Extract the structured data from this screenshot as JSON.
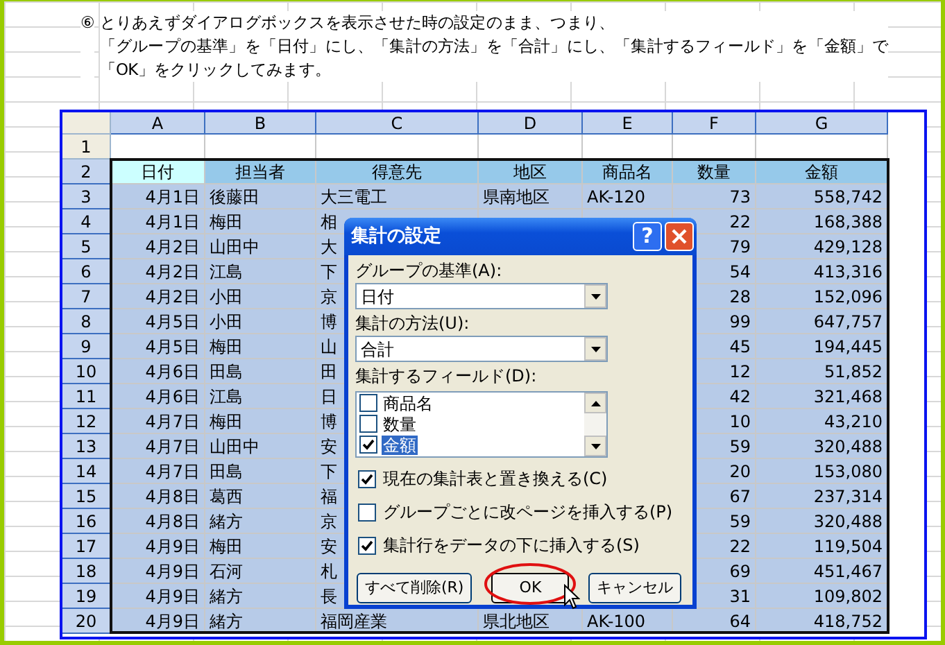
{
  "instruction": {
    "marker": "⑥",
    "lines": [
      "とりあえずダイアログボックスを表示させた時の設定のまま、つまり、",
      "「グループの基準」を「日付」にし、「集計の方法」を「合計」にし、「集計するフィールド」を「金額」で",
      "「OK」をクリックしてみます。"
    ]
  },
  "sheet": {
    "columns": [
      {
        "name": "A",
        "selected": true,
        "active": true
      },
      {
        "name": "B",
        "selected": true,
        "active": false
      },
      {
        "name": "C",
        "selected": true,
        "active": false
      },
      {
        "name": "D",
        "selected": true,
        "active": false
      },
      {
        "name": "E",
        "selected": true,
        "active": false
      },
      {
        "name": "F",
        "selected": true,
        "active": false
      },
      {
        "name": "G",
        "selected": true,
        "active": false
      }
    ],
    "rows": [
      {
        "number": "1",
        "selected": false,
        "kind": "blank",
        "cells": {}
      },
      {
        "number": "2",
        "selected": true,
        "kind": "header",
        "active": true,
        "cells": {
          "A": "日付",
          "B": "担当者",
          "C": "得意先",
          "D": "地区",
          "E": "商品名",
          "F": "数量",
          "G": "金額"
        }
      },
      {
        "number": "3",
        "selected": true,
        "kind": "data",
        "cells": {
          "A": "4月1日",
          "B": "後藤田",
          "C": "大三電工",
          "D": "県南地区",
          "E": "AK-120",
          "F": "73",
          "G": "558,742"
        }
      },
      {
        "number": "4",
        "selected": true,
        "kind": "data",
        "cells": {
          "A": "4月1日",
          "B": "梅田",
          "C": "相",
          "F": "22",
          "G": "168,388"
        }
      },
      {
        "number": "5",
        "selected": true,
        "kind": "data",
        "cells": {
          "A": "4月2日",
          "B": "山田中",
          "C": "大",
          "F": "79",
          "G": "429,128"
        }
      },
      {
        "number": "6",
        "selected": true,
        "kind": "data",
        "cells": {
          "A": "4月2日",
          "B": "江島",
          "C": "下",
          "F": "54",
          "G": "413,316"
        }
      },
      {
        "number": "7",
        "selected": true,
        "kind": "data",
        "cells": {
          "A": "4月2日",
          "B": "小田",
          "C": "京",
          "F": "28",
          "G": "152,096"
        }
      },
      {
        "number": "8",
        "selected": true,
        "kind": "data",
        "cells": {
          "A": "4月5日",
          "B": "小田",
          "C": "博",
          "F": "99",
          "G": "647,757"
        }
      },
      {
        "number": "9",
        "selected": true,
        "kind": "data",
        "cells": {
          "A": "4月5日",
          "B": "梅田",
          "C": "山",
          "F": "45",
          "G": "194,445"
        }
      },
      {
        "number": "10",
        "selected": true,
        "kind": "data",
        "cells": {
          "A": "4月6日",
          "B": "田島",
          "C": "田",
          "F": "12",
          "G": "51,852"
        }
      },
      {
        "number": "11",
        "selected": true,
        "kind": "data",
        "cells": {
          "A": "4月6日",
          "B": "江島",
          "C": "日",
          "F": "42",
          "G": "321,468"
        }
      },
      {
        "number": "12",
        "selected": true,
        "kind": "data",
        "cells": {
          "A": "4月7日",
          "B": "梅田",
          "C": "博",
          "F": "10",
          "G": "43,210"
        }
      },
      {
        "number": "13",
        "selected": true,
        "kind": "data",
        "cells": {
          "A": "4月7日",
          "B": "山田中",
          "C": "安",
          "F": "59",
          "G": "320,488"
        }
      },
      {
        "number": "14",
        "selected": true,
        "kind": "data",
        "cells": {
          "A": "4月7日",
          "B": "田島",
          "C": "下",
          "F": "20",
          "G": "153,080"
        }
      },
      {
        "number": "15",
        "selected": true,
        "kind": "data",
        "cells": {
          "A": "4月8日",
          "B": "葛西",
          "C": "福",
          "F": "67",
          "G": "237,314"
        }
      },
      {
        "number": "16",
        "selected": true,
        "kind": "data",
        "cells": {
          "A": "4月8日",
          "B": "緒方",
          "C": "京",
          "F": "59",
          "G": "320,488"
        }
      },
      {
        "number": "17",
        "selected": true,
        "kind": "data",
        "cells": {
          "A": "4月9日",
          "B": "梅田",
          "C": "安",
          "F": "22",
          "G": "119,504"
        }
      },
      {
        "number": "18",
        "selected": true,
        "kind": "data",
        "cells": {
          "A": "4月9日",
          "B": "石河",
          "C": "札",
          "F": "69",
          "G": "451,467"
        }
      },
      {
        "number": "19",
        "selected": true,
        "kind": "data",
        "cells": {
          "A": "4月9日",
          "B": "緒方",
          "C": "長",
          "F": "31",
          "G": "109,802"
        }
      },
      {
        "number": "20",
        "selected": true,
        "kind": "data",
        "cells": {
          "A": "4月9日",
          "B": "緒方",
          "C": "福岡産業",
          "D": "県北地区",
          "E": "AK-100",
          "F": "64",
          "G": "418,752"
        }
      }
    ]
  },
  "dialog": {
    "title": "集計の設定",
    "help_glyph": "?",
    "group_by": {
      "label": "グループの基準(A):",
      "value": "日付"
    },
    "function": {
      "label": "集計の方法(U):",
      "value": "合計"
    },
    "fields": {
      "label": "集計するフィールド(D):",
      "items": [
        {
          "label": "商品名",
          "checked": false,
          "selected": false
        },
        {
          "label": "数量",
          "checked": false,
          "selected": false
        },
        {
          "label": "金額",
          "checked": true,
          "selected": true
        }
      ]
    },
    "options": [
      {
        "label": "現在の集計表と置き換える(C)",
        "checked": true
      },
      {
        "label": "グループごとに改ページを挿入する(P)",
        "checked": false
      },
      {
        "label": "集計行をデータの下に挿入する(S)",
        "checked": true
      }
    ],
    "buttons": [
      {
        "label": "すべて削除(R)",
        "highlighted": false
      },
      {
        "label": "OK",
        "highlighted": true
      },
      {
        "label": "キャンセル",
        "highlighted": false
      }
    ]
  }
}
